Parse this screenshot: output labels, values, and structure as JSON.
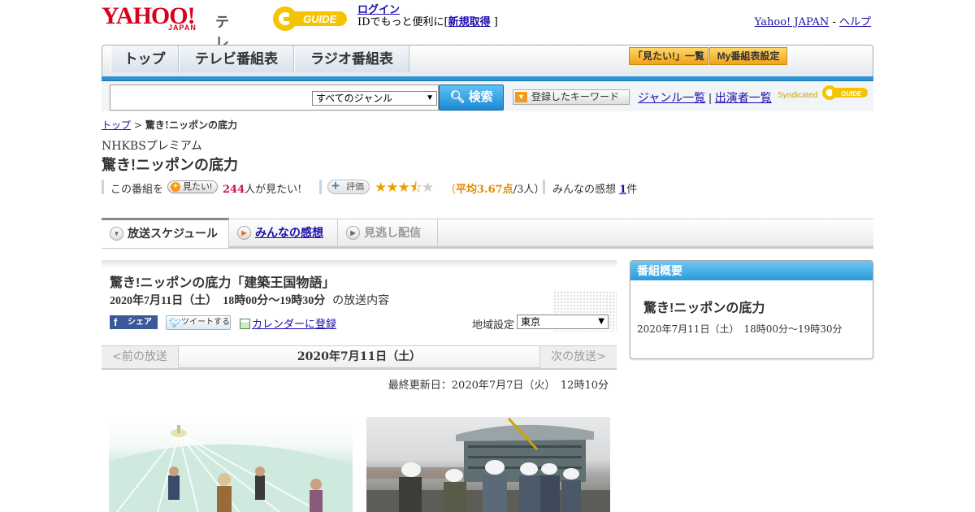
{
  "header": {
    "logo_text": "YAHOO!",
    "logo_sub": "JAPAN",
    "service_name": "テレビ",
    "gguide_logo": "G-GUIDE",
    "login_link": "ログイン",
    "id_text": "IDでもっと便利に[",
    "signup_link": "新規取得",
    "id_text_end": "]",
    "yahoo_japan_link": "Yahoo! JAPAN",
    "dash": "-",
    "help_link": "ヘルプ"
  },
  "nav": {
    "tabs": [
      {
        "label": "トップ"
      },
      {
        "label": "テレビ番組表"
      },
      {
        "label": "ラジオ番組表"
      }
    ],
    "mitai_list": "「見たい!」一覧",
    "my_schedule": "My番組表設定"
  },
  "search": {
    "placeholder": "",
    "genre_selected": "すべてのジャンル",
    "button": "検索",
    "keyword_button": "登録したキーワード",
    "genre_list_link": "ジャンル一覧",
    "separator": "|",
    "cast_list_link": "出演者一覧",
    "syndicated": "Syndicated"
  },
  "breadcrumb": {
    "home": "トップ",
    "sep": ">",
    "current": "驚き!ニッポンの底力"
  },
  "program": {
    "station": "NHKBSプレミアム",
    "title": "驚き!ニッポンの底力",
    "this_program": "この番組を",
    "mitai_button": "見たい!",
    "mitai_count": "244",
    "mitai_suffix": "人が見たい!",
    "rating_button": "評価",
    "rating_value": 3.67,
    "rating_open": "（",
    "rating_avg": "平均3.67点",
    "rating_people": "/3人）",
    "impressions_label": "みんなの感想",
    "impressions_count": "1",
    "impressions_suffix": "件"
  },
  "subtabs": [
    {
      "label": "放送スケジュール",
      "state": "active"
    },
    {
      "label": "みんなの感想",
      "state": "link"
    },
    {
      "label": "見逃し配信",
      "state": "disabled"
    }
  ],
  "episode": {
    "title": "驚き!ニッポンの底力「建築王国物語」",
    "datetime": "2020年7月11日（土）　18時00分～19時30分",
    "datetime_suffix": "の放送内容",
    "share_fb": "シェア",
    "tweet": "ツイートする",
    "calendar": "カレンダーに登録",
    "area_label": "地域設定",
    "area_selected": "東京"
  },
  "datenav": {
    "prev": "<前の放送",
    "current": "2020年7月11日（土）",
    "next": "次の放送>"
  },
  "updated": "最終更新日：2020年7月7日（火）　12時10分",
  "sidebox": {
    "header": "番組概要",
    "title": "驚き!ニッポンの底力",
    "datetime": "2020年7月11日（土）　18時00分～19時30分"
  },
  "colors": {
    "brand_red": "#d9001b",
    "nav_blue": "#2a93d6",
    "accent_orange": "#f39a1a",
    "link_blue": "#1a0dab"
  }
}
